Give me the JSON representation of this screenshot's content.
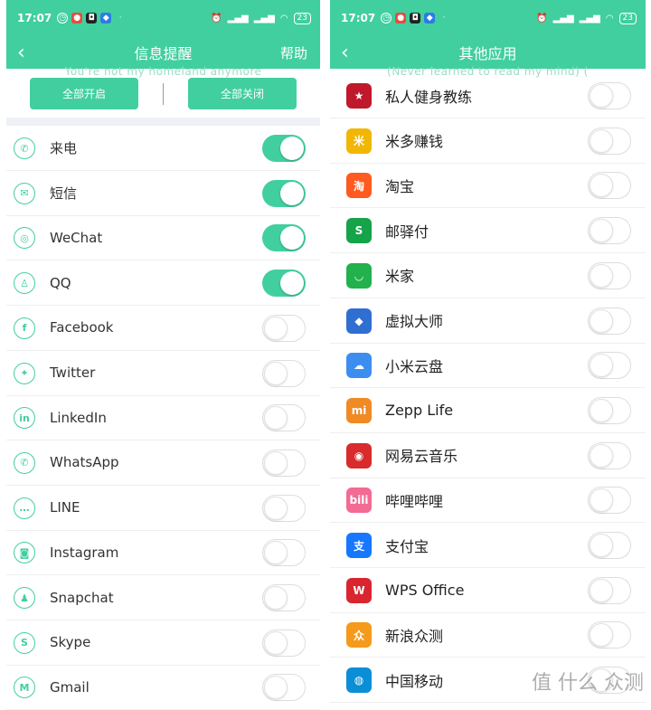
{
  "left": {
    "status": {
      "time": "17:07",
      "battery": "23"
    },
    "nav": {
      "back": "‹",
      "title": "信息提醒",
      "help": "帮助"
    },
    "ghost_text": "You're not my homeland anymore",
    "buttons": {
      "all_on": "全部开启",
      "all_off": "全部关闭"
    },
    "items": [
      {
        "label": "来电",
        "icon": "phone-icon",
        "glyph": "✆",
        "on": true
      },
      {
        "label": "短信",
        "icon": "message-icon",
        "glyph": "✉",
        "on": true
      },
      {
        "label": "WeChat",
        "icon": "wechat-icon",
        "glyph": "◎",
        "on": true
      },
      {
        "label": "QQ",
        "icon": "qq-icon",
        "glyph": "♙",
        "on": true
      },
      {
        "label": "Facebook",
        "icon": "facebook-icon",
        "glyph": "f",
        "on": false
      },
      {
        "label": "Twitter",
        "icon": "twitter-icon",
        "glyph": "✦",
        "on": false
      },
      {
        "label": "LinkedIn",
        "icon": "linkedin-icon",
        "glyph": "in",
        "on": false
      },
      {
        "label": "WhatsApp",
        "icon": "whatsapp-icon",
        "glyph": "✆",
        "on": false
      },
      {
        "label": "LINE",
        "icon": "line-icon",
        "glyph": "…",
        "on": false
      },
      {
        "label": "Instagram",
        "icon": "instagram-icon",
        "glyph": "◙",
        "on": false
      },
      {
        "label": "Snapchat",
        "icon": "snapchat-icon",
        "glyph": "♟",
        "on": false
      },
      {
        "label": "Skype",
        "icon": "skype-icon",
        "glyph": "S",
        "on": false
      },
      {
        "label": "Gmail",
        "icon": "gmail-icon",
        "glyph": "M",
        "on": false
      }
    ]
  },
  "right": {
    "status": {
      "time": "17:07",
      "battery": "23"
    },
    "nav": {
      "back": "‹",
      "title": "其他应用"
    },
    "ghost_text": "(Never learned to read my mind) (",
    "apps": [
      {
        "label": "私人健身教练",
        "icon": "fitness-coach-icon",
        "glyph": "★",
        "color": "#c0192b",
        "on": false
      },
      {
        "label": "米多赚钱",
        "icon": "miduo-icon",
        "glyph": "米",
        "color": "#f2b705",
        "on": false
      },
      {
        "label": "淘宝",
        "icon": "taobao-icon",
        "glyph": "淘",
        "color": "#ff5a1f",
        "on": false
      },
      {
        "label": "邮驿付",
        "icon": "youyifu-icon",
        "glyph": "S",
        "color": "#17a34a",
        "on": false
      },
      {
        "label": "米家",
        "icon": "mijia-icon",
        "glyph": "◡",
        "color": "#22b14c",
        "on": false
      },
      {
        "label": "虚拟大师",
        "icon": "vmos-icon",
        "glyph": "◆",
        "color": "#2f6fd1",
        "on": false
      },
      {
        "label": "小米云盘",
        "icon": "mi-cloud-icon",
        "glyph": "☁",
        "color": "#3b8ef0",
        "on": false
      },
      {
        "label": "Zepp Life",
        "icon": "zepp-life-icon",
        "glyph": "mi",
        "color": "#f08a24",
        "on": false
      },
      {
        "label": "网易云音乐",
        "icon": "netease-music-icon",
        "glyph": "◉",
        "color": "#d92b2b",
        "on": false
      },
      {
        "label": "哔哩哔哩",
        "icon": "bilibili-icon",
        "glyph": "bili",
        "color": "#f36a93",
        "on": false
      },
      {
        "label": "支付宝",
        "icon": "alipay-icon",
        "glyph": "支",
        "color": "#1677ff",
        "on": false
      },
      {
        "label": "WPS Office",
        "icon": "wps-icon",
        "glyph": "W",
        "color": "#d9252f",
        "on": false
      },
      {
        "label": "新浪众测",
        "icon": "sina-test-icon",
        "glyph": "众",
        "color": "#f59a1b",
        "on": false
      },
      {
        "label": "中国移动",
        "icon": "china-mobile-icon",
        "glyph": "◍",
        "color": "#0a8ed6",
        "on": false
      }
    ]
  },
  "watermark": "值 什么 众测"
}
